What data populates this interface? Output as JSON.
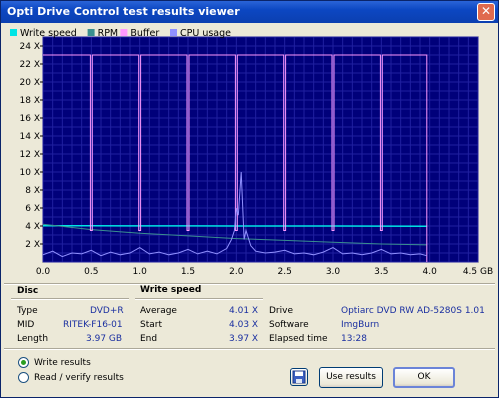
{
  "window": {
    "title": "Opti Drive Control test results viewer",
    "close_glyph": "✕"
  },
  "legend": [
    {
      "label": "Write speed",
      "color": "#00e5e5"
    },
    {
      "label": "RPM",
      "color": "#3a8f8f"
    },
    {
      "label": "Buffer",
      "color": "#ff99ff"
    },
    {
      "label": "CPU usage",
      "color": "#9090ff"
    }
  ],
  "chart_data": {
    "type": "line",
    "y_tick_labels": [
      "24 X",
      "22 X",
      "20 X",
      "18 X",
      "16 X",
      "14 X",
      "12 X",
      "10 X",
      "8 X",
      "6 X",
      "4 X",
      "2 X"
    ],
    "x_tick_labels": [
      "0.0",
      "0.5",
      "1.0",
      "1.5",
      "2.0",
      "2.5",
      "3.0",
      "3.5",
      "4.0",
      "4.5 GB"
    ],
    "xlim": [
      0,
      4.5
    ],
    "ylim": [
      0,
      25
    ],
    "grid": true,
    "series": [
      {
        "name": "Write speed",
        "color": "#00e5e5",
        "x": [
          0,
          0.5,
          1.0,
          1.5,
          2.0,
          2.5,
          3.0,
          3.5,
          3.97
        ],
        "values": [
          4.03,
          4.02,
          4.01,
          4.01,
          4.0,
          4.0,
          4.0,
          3.99,
          3.97
        ]
      },
      {
        "name": "RPM",
        "color": "#3a8f8f",
        "x": [
          0,
          0.5,
          1.0,
          1.5,
          2.0,
          2.5,
          3.0,
          3.5,
          3.97
        ],
        "values": [
          4.2,
          3.6,
          3.2,
          2.9,
          2.6,
          2.4,
          2.2,
          2.0,
          1.9
        ]
      },
      {
        "name": "Buffer",
        "color": "#ff99ff",
        "x": [
          0,
          0.49,
          0.49,
          0.51,
          0.51,
          0.99,
          0.99,
          1.01,
          1.01,
          1.49,
          1.49,
          1.51,
          1.51,
          1.99,
          1.99,
          2.01,
          2.01,
          2.49,
          2.49,
          2.51,
          2.51,
          2.99,
          2.99,
          3.01,
          3.01,
          3.49,
          3.49,
          3.51,
          3.51,
          3.97,
          3.97
        ],
        "values": [
          23,
          23,
          3.5,
          3.5,
          23,
          23,
          3.5,
          3.5,
          23,
          23,
          3.5,
          3.5,
          23,
          23,
          3.5,
          3.5,
          23,
          23,
          3.5,
          3.5,
          23,
          23,
          3.5,
          3.5,
          23,
          23,
          3.5,
          3.5,
          23,
          23,
          0
        ]
      },
      {
        "name": "CPU usage",
        "color": "#9090ff",
        "x": [
          0,
          0.1,
          0.2,
          0.3,
          0.4,
          0.5,
          0.6,
          0.7,
          0.8,
          0.9,
          1.0,
          1.1,
          1.2,
          1.3,
          1.4,
          1.5,
          1.6,
          1.7,
          1.8,
          1.9,
          1.95,
          1.98,
          2.0,
          2.02,
          2.05,
          2.08,
          2.1,
          2.15,
          2.2,
          2.3,
          2.4,
          2.5,
          2.6,
          2.7,
          2.8,
          2.9,
          3.0,
          3.1,
          3.2,
          3.3,
          3.4,
          3.5,
          3.6,
          3.7,
          3.8,
          3.9,
          3.97
        ],
        "values": [
          0.8,
          1.2,
          0.6,
          1.0,
          0.9,
          1.3,
          0.7,
          1.1,
          0.8,
          1.0,
          1.6,
          0.9,
          1.1,
          0.8,
          1.0,
          1.4,
          0.9,
          1.2,
          0.9,
          1.5,
          2.5,
          3.5,
          6.0,
          5.2,
          10.0,
          2.5,
          3.5,
          1.8,
          1.2,
          1.0,
          1.1,
          1.3,
          0.9,
          1.0,
          0.8,
          1.1,
          1.6,
          0.9,
          1.0,
          0.8,
          1.0,
          1.4,
          0.9,
          1.0,
          0.8,
          0.9,
          0.7
        ]
      }
    ]
  },
  "disc": {
    "title": "Disc",
    "rows": [
      {
        "label": "Type",
        "value": "DVD+R"
      },
      {
        "label": "MID",
        "value": "RITEK-F16-01"
      },
      {
        "label": "Length",
        "value": "3.97 GB"
      }
    ]
  },
  "write_speed": {
    "title": "Write speed",
    "rows": [
      {
        "label": "Average",
        "value": "4.01 X"
      },
      {
        "label": "Start",
        "value": "4.03 X"
      },
      {
        "label": "End",
        "value": "3.97 X"
      }
    ]
  },
  "drive": {
    "rows": [
      {
        "label": "Drive",
        "value": "Optiarc  DVD RW AD-5280S 1.01"
      },
      {
        "label": "Software",
        "value": "ImgBurn"
      },
      {
        "label": "Elapsed time",
        "value": "13:28"
      }
    ]
  },
  "options": {
    "write_results": "Write results",
    "read_verify_results": "Read / verify results",
    "selected": "write_results"
  },
  "buttons": {
    "use_results": "Use results",
    "ok": "OK",
    "save_icon": "floppy-disk-icon"
  }
}
